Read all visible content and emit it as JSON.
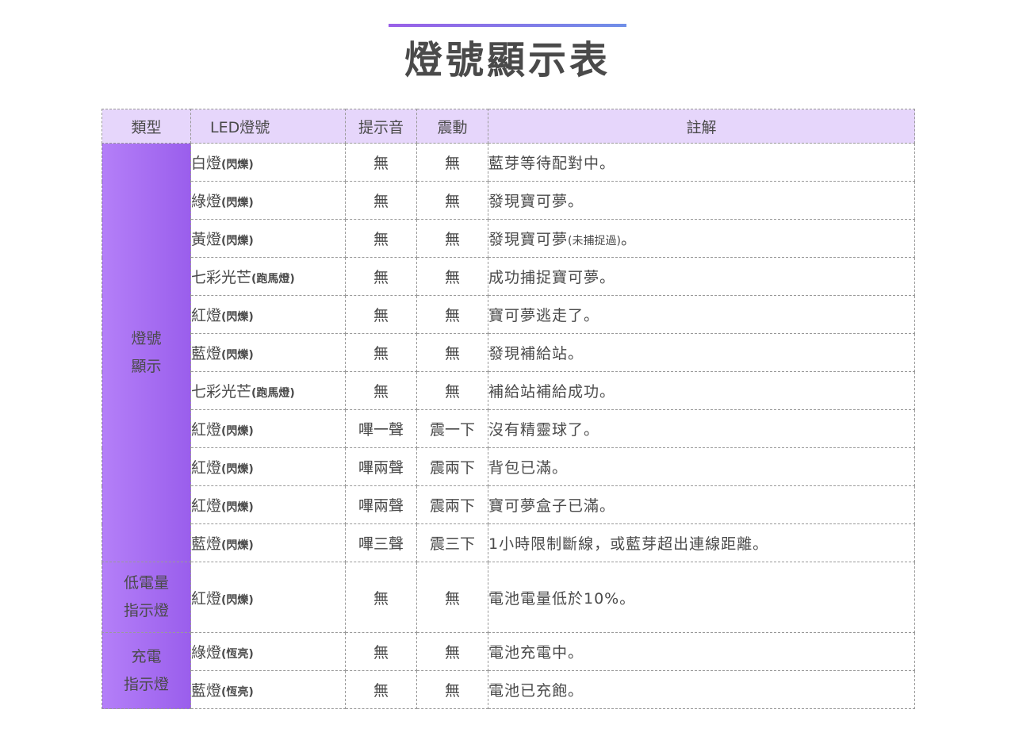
{
  "title": "燈號顯示表",
  "headers": {
    "type": "類型",
    "led": "LED燈號",
    "sound": "提示音",
    "vibration": "震動",
    "note": "註解"
  },
  "groups": [
    {
      "label_line1": "燈號",
      "label_line2": "顯示"
    },
    {
      "label_line1": "低電量",
      "label_line2": "指示燈"
    },
    {
      "label_line1": "充電",
      "label_line2": "指示燈"
    }
  ],
  "rows": [
    {
      "led": "白燈",
      "led_sub": "(閃爍)",
      "sound": "無",
      "vibration": "無",
      "note": "藍芽等待配對中。",
      "note_sub": ""
    },
    {
      "led": "綠燈",
      "led_sub": "(閃爍)",
      "sound": "無",
      "vibration": "無",
      "note": "發現寶可夢。",
      "note_sub": ""
    },
    {
      "led": "黃燈",
      "led_sub": "(閃爍)",
      "sound": "無",
      "vibration": "無",
      "note": "發現寶可夢",
      "note_sub": "(未捕捉過)",
      "note_end": "。"
    },
    {
      "led": "七彩光芒",
      "led_sub": "(跑馬燈)",
      "sound": "無",
      "vibration": "無",
      "note": "成功捕捉寶可夢。",
      "note_sub": ""
    },
    {
      "led": "紅燈",
      "led_sub": "(閃爍)",
      "sound": "無",
      "vibration": "無",
      "note": "寶可夢逃走了。",
      "note_sub": ""
    },
    {
      "led": "藍燈",
      "led_sub": "(閃爍)",
      "sound": "無",
      "vibration": "無",
      "note": "發現補給站。",
      "note_sub": ""
    },
    {
      "led": "七彩光芒",
      "led_sub": "(跑馬燈)",
      "sound": "無",
      "vibration": "無",
      "note": "補給站補給成功。",
      "note_sub": ""
    },
    {
      "led": "紅燈",
      "led_sub": "(閃爍)",
      "sound": "嗶一聲",
      "vibration": "震一下",
      "note": "沒有精靈球了。",
      "note_sub": ""
    },
    {
      "led": "紅燈",
      "led_sub": "(閃爍)",
      "sound": "嗶兩聲",
      "vibration": "震兩下",
      "note": "背包已滿。",
      "note_sub": ""
    },
    {
      "led": "紅燈",
      "led_sub": "(閃爍)",
      "sound": "嗶兩聲",
      "vibration": "震兩下",
      "note": "寶可夢盒子已滿。",
      "note_sub": ""
    },
    {
      "led": "藍燈",
      "led_sub": "(閃爍)",
      "sound": "嗶三聲",
      "vibration": "震三下",
      "note": "1小時限制斷線，或藍芽超出連線距離。",
      "note_sub": ""
    },
    {
      "led": "紅燈",
      "led_sub": "(閃爍)",
      "sound": "無",
      "vibration": "無",
      "note": "電池電量低於10%。",
      "note_sub": ""
    },
    {
      "led": "綠燈",
      "led_sub": "(恆亮)",
      "sound": "無",
      "vibration": "無",
      "note": "電池充電中。",
      "note_sub": ""
    },
    {
      "led": "藍燈",
      "led_sub": "(恆亮)",
      "sound": "無",
      "vibration": "無",
      "note": "電池已充飽。",
      "note_sub": ""
    }
  ],
  "colors": {
    "header_bg": "#e6d6fb",
    "type_cell": "#a16cf0",
    "title_bar": "#9a60e8"
  }
}
